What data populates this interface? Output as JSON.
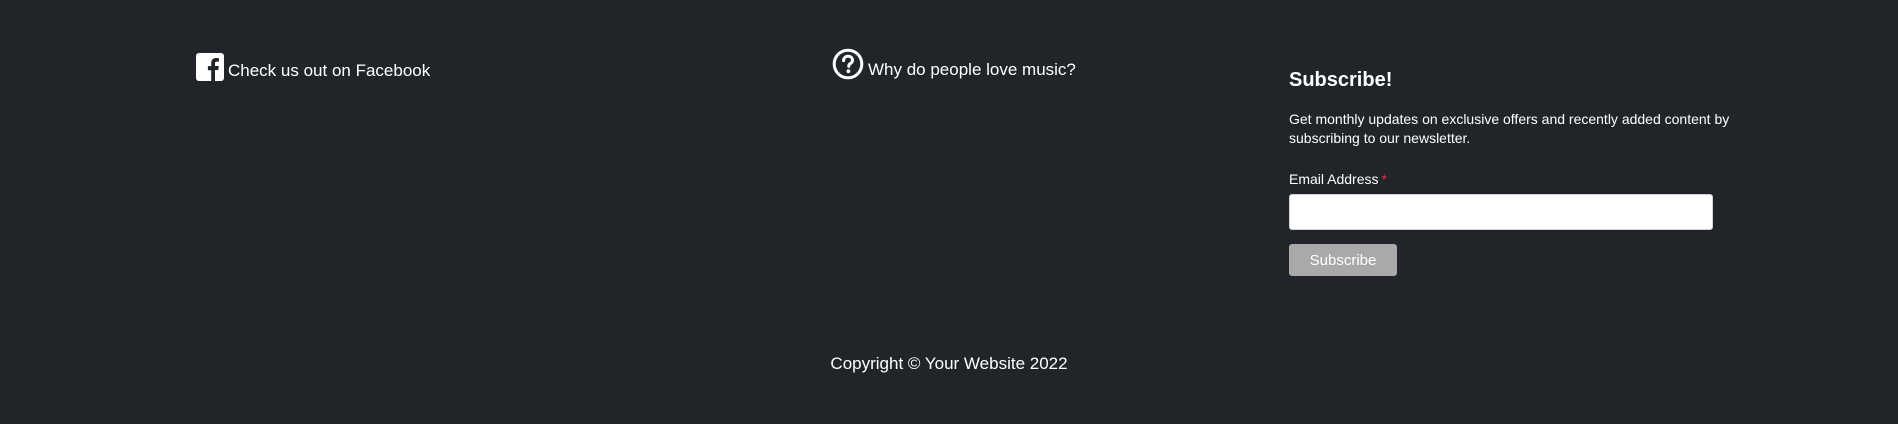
{
  "footer": {
    "facebook": {
      "label": "Check us out on Facebook",
      "icon": "facebook-icon"
    },
    "music": {
      "label": "Why do people love music?",
      "icon": "question-circle-icon"
    },
    "subscribe": {
      "title": "Subscribe!",
      "description": "Get monthly updates on exclusive offers and recently added content by subscribing to our newsletter.",
      "email_label": "Email Address",
      "required_marker": "*",
      "email_value": "",
      "button_label": "Subscribe"
    },
    "copyright": "Copyright © Your Website 2022"
  },
  "colors": {
    "background": "#212529",
    "text": "#ffffff",
    "required": "#dc3545",
    "button": "#a9a9a9"
  }
}
